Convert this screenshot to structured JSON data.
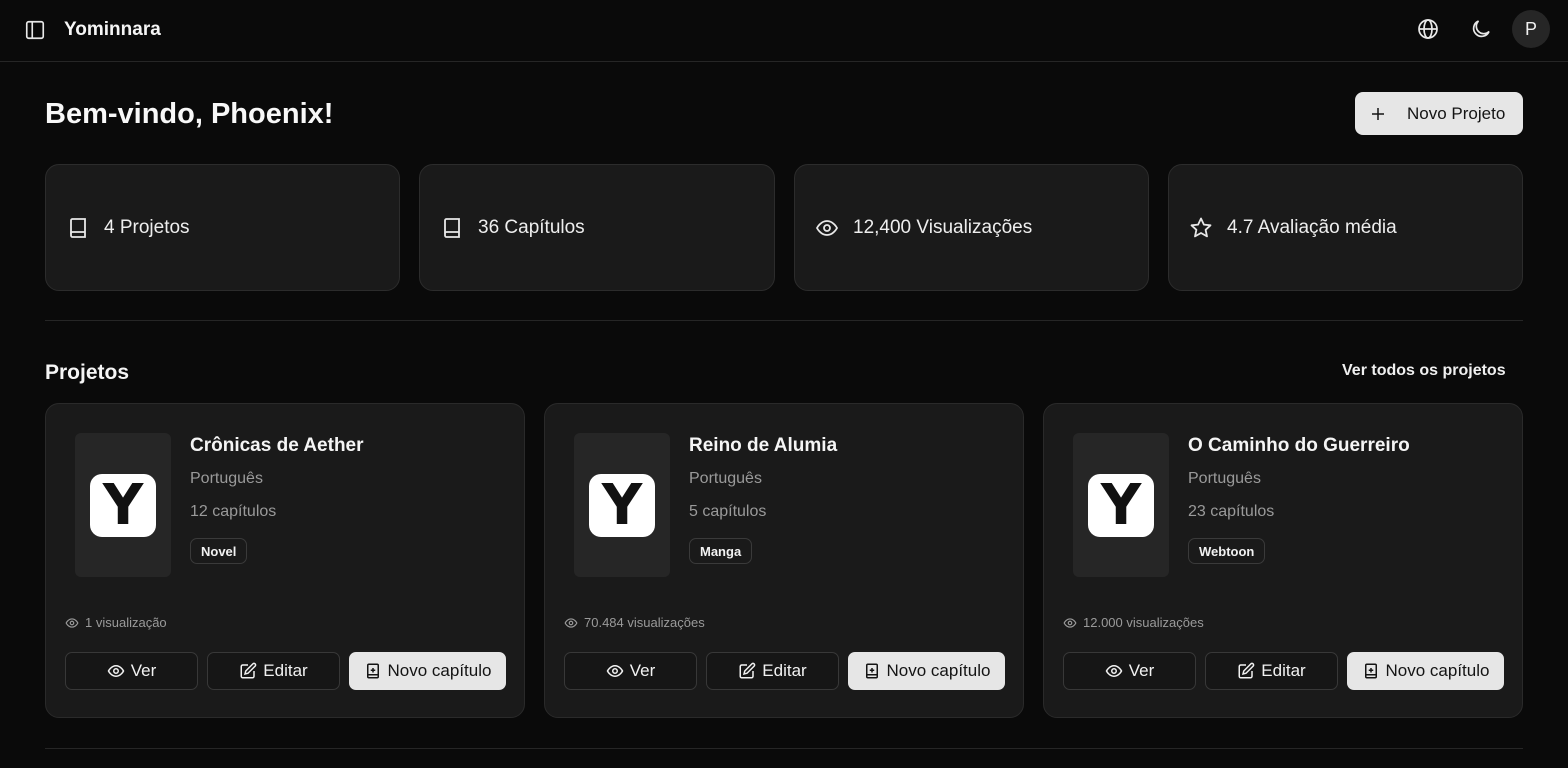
{
  "header": {
    "app_title": "Yominnara",
    "avatar_initial": "P"
  },
  "welcome": "Bem-vindo, Phoenix!",
  "new_project_label": "Novo Projeto",
  "stats": [
    {
      "label": "4 Projetos",
      "icon": "book-icon"
    },
    {
      "label": "36 Capítulos",
      "icon": "book-icon"
    },
    {
      "label": "12,400 Visualizações",
      "icon": "eye-icon"
    },
    {
      "label": "4.7 Avaliação média",
      "icon": "star-icon"
    }
  ],
  "projects_section": {
    "title": "Projetos",
    "see_all": "Ver todos os projetos"
  },
  "projects": [
    {
      "title": "Crônicas de Aether",
      "language": "Português",
      "chapters": "12 capítulos",
      "badge": "Novel",
      "views": "1 visualização",
      "cover_letter": "Y"
    },
    {
      "title": "Reino de Alumia",
      "language": "Português",
      "chapters": "5 capítulos",
      "badge": "Manga",
      "views": "70.484 visualizações",
      "cover_letter": "Y"
    },
    {
      "title": "O Caminho do Guerreiro",
      "language": "Português",
      "chapters": "23 capítulos",
      "badge": "Webtoon",
      "views": "12.000 visualizações",
      "cover_letter": "Y"
    }
  ],
  "card_actions": {
    "view": "Ver",
    "edit": "Editar",
    "new_chapter": "Novo capítulo"
  }
}
